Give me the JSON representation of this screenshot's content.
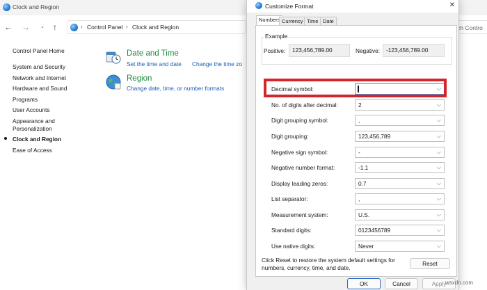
{
  "control_panel": {
    "window_title": "Clock and Region",
    "breadcrumb": [
      "Control Panel",
      "Clock and Region"
    ],
    "search_placeholder": "Search Control Panel",
    "search_visible_text": "ch Contro",
    "sidebar": {
      "items": [
        {
          "label": "Control Panel Home"
        },
        {
          "label": "System and Security"
        },
        {
          "label": "Network and Internet"
        },
        {
          "label": "Hardware and Sound"
        },
        {
          "label": "Programs"
        },
        {
          "label": "User Accounts"
        },
        {
          "label": "Appearance and"
        },
        {
          "label": "Personalization"
        },
        {
          "label": "Clock and Region",
          "active": true
        },
        {
          "label": "Ease of Access"
        }
      ]
    },
    "categories": [
      {
        "title": "Date and Time",
        "links": [
          "Set the time and date",
          "Change the time zo"
        ]
      },
      {
        "title": "Region",
        "links": [
          "Change date, time, or number formats"
        ]
      }
    ]
  },
  "dialog": {
    "title": "Customize Format",
    "close_glyph": "✕",
    "tabs": [
      "Numbers",
      "Currency",
      "Time",
      "Date"
    ],
    "active_tab": "Numbers",
    "example": {
      "legend": "Example",
      "positive_label": "Positive:",
      "positive_value": "123,456,789.00",
      "negative_label": "Negative:",
      "negative_value": "-123,456,789.00"
    },
    "settings": [
      {
        "label": "Decimal symbol:",
        "value": ""
      },
      {
        "label": "No. of digits after decimal:",
        "value": "2"
      },
      {
        "label": "Digit grouping symbol:",
        "value": ","
      },
      {
        "label": "Digit grouping:",
        "value": "123,456,789"
      },
      {
        "label": "Negative sign symbol:",
        "value": "-"
      },
      {
        "label": "Negative number format:",
        "value": "-1.1"
      },
      {
        "label": "Display leading zeros:",
        "value": "0.7"
      },
      {
        "label": "List separator:",
        "value": ","
      },
      {
        "label": "Measurement system:",
        "value": "U.S."
      },
      {
        "label": "Standard digits:",
        "value": "0123456789"
      },
      {
        "label": "Use native digits:",
        "value": "Never"
      }
    ],
    "reset_text": "Click Reset to restore the system default settings for numbers, currency, time, and date.",
    "reset_label": "Reset",
    "ok_label": "OK",
    "cancel_label": "Cancel",
    "apply_label": "Apply"
  },
  "colors": {
    "highlight_border": "#d4252b",
    "category_title": "#1e8a3e",
    "link": "#1a5bb5"
  },
  "icons": [
    "globe-icon",
    "back-arrow-icon",
    "forward-arrow-icon",
    "up-arrow-icon",
    "chevron-down-icon",
    "clock-icon",
    "region-globe-icon",
    "close-icon"
  ],
  "watermark": "wsxdn.com"
}
